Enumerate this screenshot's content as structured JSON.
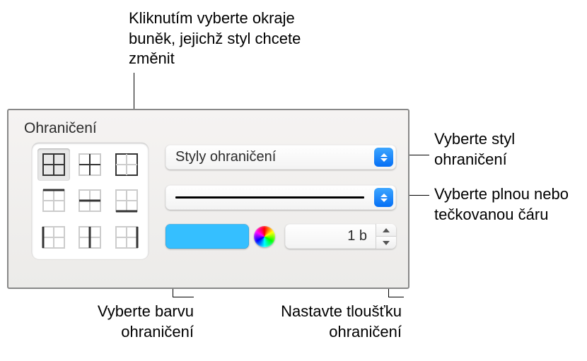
{
  "callouts": {
    "top_border_grid": "Kliknutím vyberte okraje buněk, jejichž styl chcete změnit",
    "right_style": "Vyberte styl ohraničení",
    "right_line": "Vyberte plnou nebo tečkovanou čáru",
    "bottom_color": "Vyberte barvu ohraničení",
    "bottom_thickness": "Nastavte tloušťku ohraničení"
  },
  "panel": {
    "title": "Ohraničení",
    "style_dropdown_label": "Styly ohraničení",
    "thickness_value": "1 b",
    "color": "#35bfff"
  }
}
